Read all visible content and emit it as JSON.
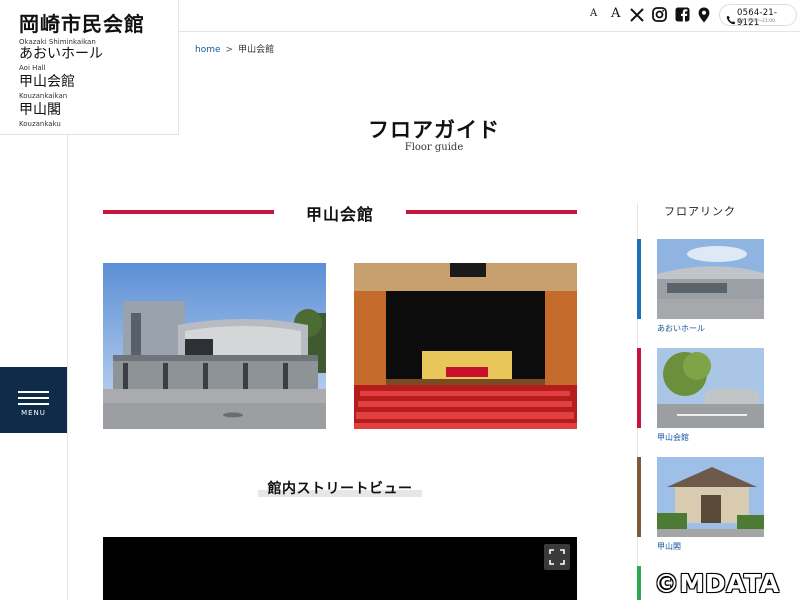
{
  "venues": [
    {
      "jp": "岡崎市民会館",
      "en": "Okazaki Shiminkaikan"
    },
    {
      "jp": "あおいホール",
      "en": "Aoi Hall"
    },
    {
      "jp": "甲山会館",
      "en": "Kouzankaikan"
    },
    {
      "jp": "甲山閣",
      "en": "Kouzankaku"
    }
  ],
  "header": {
    "font_small": "A",
    "font_large": "A",
    "phone": "0564-21-9121",
    "hours": "受付 9:00～21:00",
    "icons": [
      "x-icon",
      "instagram-icon",
      "facebook-icon",
      "map-pin-icon",
      "phone-icon"
    ]
  },
  "menu": {
    "label": "MENU"
  },
  "breadcrumb": {
    "home": "home",
    "separator": ">",
    "current": "甲山会館"
  },
  "page": {
    "title": "フロアガイド",
    "subtitle": "Floor guide"
  },
  "section": {
    "title": "甲山会館",
    "accent_color": "#c8143c"
  },
  "streetview": {
    "title": "館内ストリートビュー"
  },
  "floor_links": {
    "heading": "フロアリンク",
    "items": [
      {
        "label": "あおいホール",
        "color": "#1d6fb8"
      },
      {
        "label": "甲山会館",
        "color": "#c8143c"
      },
      {
        "label": "甲山閣",
        "color": "#7a5b3a"
      },
      {
        "label": "",
        "color": "#2fa84f"
      }
    ]
  },
  "watermark": "©MDATA",
  "colors": {
    "navy": "#0e2c48",
    "link": "#1a5aa0"
  }
}
